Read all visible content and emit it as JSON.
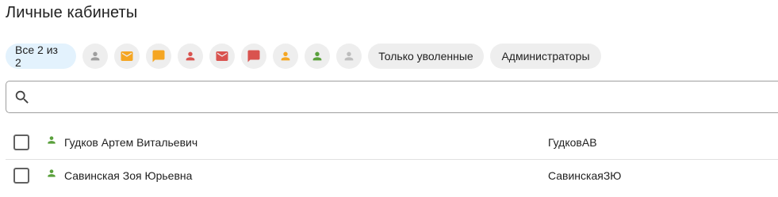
{
  "title": "Личные кабинеты",
  "filters": {
    "all_label": "Все 2 из 2",
    "icon_chips": [
      {
        "icon": "person-icon",
        "color": "#9e9e9e"
      },
      {
        "icon": "mail-icon",
        "color": "#f5a623"
      },
      {
        "icon": "chat-icon",
        "color": "#f5a623"
      },
      {
        "icon": "person-icon",
        "color": "#d9534f"
      },
      {
        "icon": "mail-icon",
        "color": "#d9534f"
      },
      {
        "icon": "chat-icon",
        "color": "#d9534f"
      },
      {
        "icon": "person-icon",
        "color": "#f5a623"
      },
      {
        "icon": "person-icon",
        "color": "#5aa03c"
      },
      {
        "icon": "person-icon",
        "color": "#bdbdbd"
      }
    ],
    "fired_label": "Только уволенные",
    "admins_label": "Администраторы"
  },
  "search": {
    "placeholder": "",
    "value": ""
  },
  "rows": [
    {
      "name": "Гудков Артем Витальевич",
      "login": "ГудковАВ",
      "status_icon": "person-icon",
      "status_color": "#5aa03c",
      "checked": false
    },
    {
      "name": "Савинская Зоя Юрьевна",
      "login": "СавинскаяЗЮ",
      "status_icon": "person-icon",
      "status_color": "#5aa03c",
      "checked": false
    }
  ]
}
